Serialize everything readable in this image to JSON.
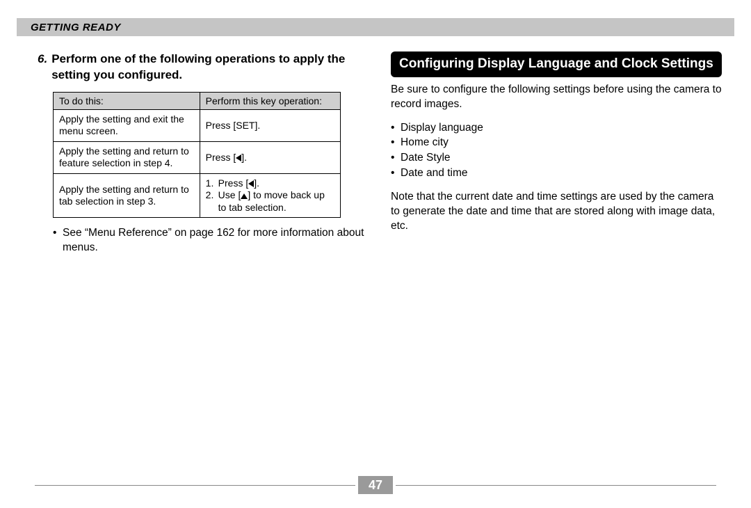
{
  "header": "GETTING READY",
  "left": {
    "step_number": "6.",
    "step_text": "Perform one of the following operations to apply the setting you configured.",
    "table": {
      "col1": "To do this:",
      "col2": "Perform this key operation:",
      "rows": [
        {
          "action": "Apply the setting and exit the menu screen.",
          "op": "Press [SET]."
        },
        {
          "action": "Apply the setting and return to feature selection in step 4.",
          "op_prefix": "Press [",
          "op_suffix": "]."
        },
        {
          "action": "Apply the setting and return to tab selection in step 3.",
          "step1_prefix": "Press [",
          "step1_suffix": "].",
          "step2_prefix": "Use [",
          "step2_suffix": "] to move back up to tab selection."
        }
      ]
    },
    "note": "See “Menu Reference” on page 162 for more information about menus."
  },
  "right": {
    "heading": "Configuring Display Language and Clock Settings",
    "intro": "Be sure to configure the following settings before using the camera to record images.",
    "bullets": [
      "Display language",
      "Home city",
      "Date Style",
      "Date and time"
    ],
    "note": "Note that the current date and time settings are used by the camera to generate the date and time that are stored along with image data, etc."
  },
  "page_number": "47"
}
